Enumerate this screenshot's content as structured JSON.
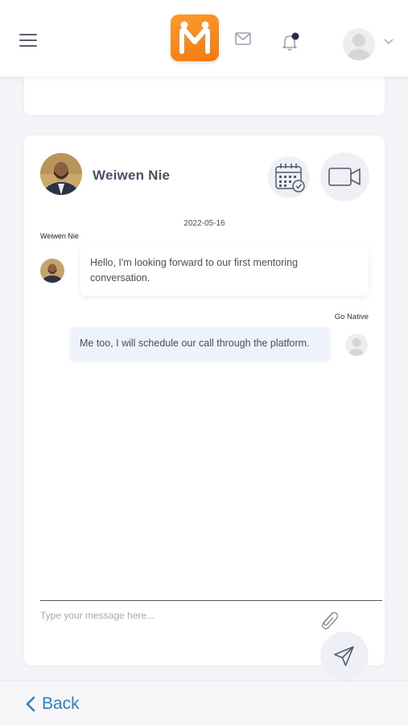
{
  "header": {
    "menu_icon": "hamburger-icon",
    "logo_letter": "M",
    "mail_icon": "mail-icon",
    "bell_icon": "bell-icon",
    "avatar_icon": "user-avatar-icon",
    "dropdown_icon": "chevron-down-icon",
    "colors": {
      "logo": "#f5821f",
      "notification_dot": "#2a2e45"
    }
  },
  "chat": {
    "contact_name": "Weiwen Nie",
    "schedule_icon": "calendar-check-icon",
    "video_icon": "video-camera-icon",
    "messages": [
      {
        "date": "2022-05-16",
        "sender": "Weiwen Nie",
        "text": "Hello, I'm looking forward to our first mentoring conversation.",
        "direction": "incoming"
      },
      {
        "sender": "Go Native",
        "text": "Me too, I will schedule our call through the platform.",
        "direction": "outgoing"
      }
    ],
    "input": {
      "placeholder": "Type your message here...",
      "value": ""
    },
    "attach_icon": "paperclip-icon",
    "send_icon": "send-icon"
  },
  "footer": {
    "back_label": "Back",
    "back_icon": "chevron-left-icon",
    "accent": "#2f7fc2"
  }
}
